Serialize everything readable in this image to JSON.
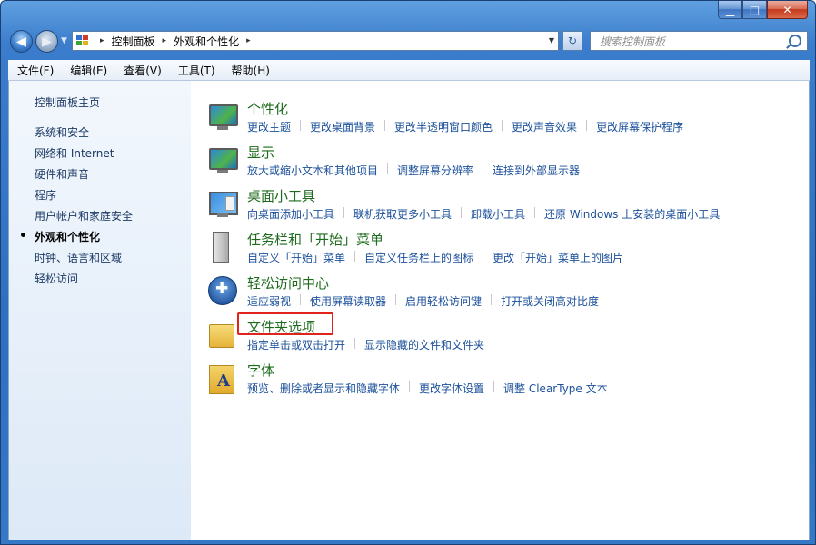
{
  "window": {
    "min_label": "▁",
    "max_label": "□",
    "close_label": "✕"
  },
  "address": {
    "crumbs": [
      "控制面板",
      "外观和个性化"
    ],
    "separator": "▸"
  },
  "search": {
    "placeholder": "搜索控制面板"
  },
  "menu": [
    "文件(F)",
    "编辑(E)",
    "查看(V)",
    "工具(T)",
    "帮助(H)"
  ],
  "sidebar": {
    "items": [
      {
        "label": "控制面板主页",
        "active": false
      },
      {
        "label": "系统和安全",
        "active": false
      },
      {
        "label": "网络和 Internet",
        "active": false
      },
      {
        "label": "硬件和声音",
        "active": false
      },
      {
        "label": "程序",
        "active": false
      },
      {
        "label": "用户帐户和家庭安全",
        "active": false
      },
      {
        "label": "外观和个性化",
        "active": true
      },
      {
        "label": "时钟、语言和区域",
        "active": false
      },
      {
        "label": "轻松访问",
        "active": false
      }
    ]
  },
  "categories": [
    {
      "title": "个性化",
      "icon": "personalization-icon",
      "links": [
        "更改主题",
        "更改桌面背景",
        "更改半透明窗口颜色",
        "更改声音效果",
        "更改屏幕保护程序"
      ]
    },
    {
      "title": "显示",
      "icon": "display-icon",
      "links": [
        "放大或缩小文本和其他项目",
        "调整屏幕分辨率",
        "连接到外部显示器"
      ]
    },
    {
      "title": "桌面小工具",
      "icon": "gadgets-icon",
      "links": [
        "向桌面添加小工具",
        "联机获取更多小工具",
        "卸载小工具",
        "还原 Windows 上安装的桌面小工具"
      ]
    },
    {
      "title": "任务栏和「开始」菜单",
      "icon": "taskbar-icon",
      "links": [
        "自定义「开始」菜单",
        "自定义任务栏上的图标",
        "更改「开始」菜单上的图片"
      ]
    },
    {
      "title": "轻松访问中心",
      "icon": "ease-of-access-icon",
      "links": [
        "适应弱视",
        "使用屏幕读取器",
        "启用轻松访问键",
        "打开或关闭高对比度"
      ]
    },
    {
      "title": "文件夹选项",
      "icon": "folder-options-icon",
      "links": [
        "指定单击或双击打开",
        "显示隐藏的文件和文件夹"
      ]
    },
    {
      "title": "字体",
      "icon": "fonts-icon",
      "links": [
        "预览、删除或者显示和隐藏字体",
        "更改字体设置",
        "调整 ClearType 文本"
      ]
    }
  ],
  "colors": {
    "category_title": "#1e6b1e",
    "link": "#1a4f9a",
    "highlight": "#e0241c"
  }
}
